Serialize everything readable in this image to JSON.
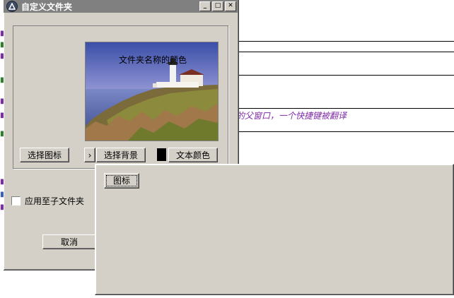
{
  "dialog": {
    "title": "自定义文件夹",
    "icon": "app-logo-icon",
    "title_buttons": {
      "minimize": "_",
      "maximize": "□",
      "close": "✕"
    },
    "preview_label": "文件夹名称的颜色",
    "buttons": {
      "select_icon": "选择图标",
      "arrow": "›",
      "select_background": "选择背景",
      "text_color": "文本颜色",
      "cancel": "取消"
    },
    "text_color_value": "#000000",
    "apply_subfolders": "应用至子文件夹",
    "apply_subfolders_checked": false
  },
  "panel": {
    "button": "图标"
  },
  "background_doc": {
    "italic_line": "艾的父窗口，一个快捷键被翻译"
  },
  "colors": {
    "face": "#d4d0c8",
    "titlebar_inactive": "#808080",
    "italic_text": "#7f2aa6"
  }
}
